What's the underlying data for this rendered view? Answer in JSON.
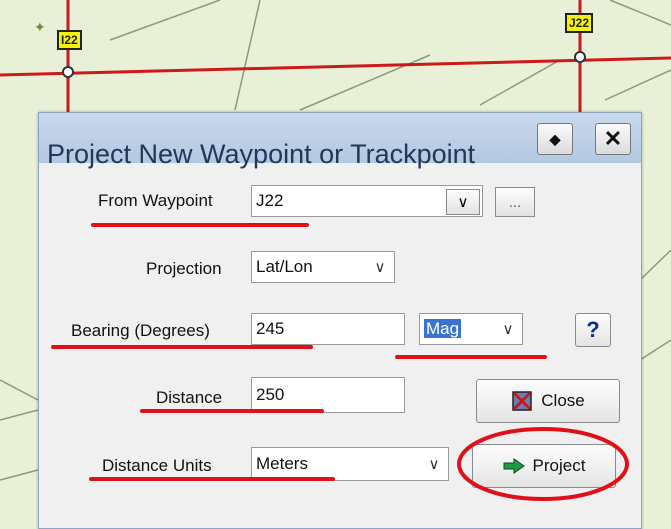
{
  "map": {
    "waypoint_left": "I22",
    "waypoint_right": "J22"
  },
  "dialog": {
    "title": "Project New Waypoint or Trackpoint",
    "pin_glyph": "◆",
    "close_glyph": "✕",
    "from_waypoint": {
      "label": "From Waypoint",
      "value": "J22",
      "browse_label": "..."
    },
    "projection": {
      "label": "Projection",
      "value": "Lat/Lon"
    },
    "bearing": {
      "label": "Bearing (Degrees)",
      "value": "245",
      "reference": "Mag"
    },
    "help_label": "?",
    "distance": {
      "label": "Distance",
      "value": "250"
    },
    "distance_units": {
      "label": "Distance Units",
      "value": "Meters"
    },
    "close_label": "Close",
    "project_label": "Project"
  },
  "colors": {
    "annotation_red": "#e0101a",
    "waypoint_fill": "#f2f20a"
  }
}
